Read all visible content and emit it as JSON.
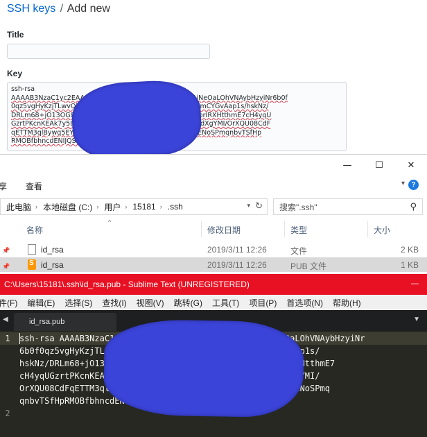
{
  "web": {
    "breadcrumb_link": "SSH keys",
    "breadcrumb_sep": "/",
    "breadcrumb_current": "Add new",
    "title_label": "Title",
    "key_label": "Key",
    "key_lines": [
      "ssh-rsa",
      "AAAAB3NzaC1yc2EAAAADAQABAAABAQDZ5Eb1RUGip1iNeOaLOhVNAybHzyiNr6b0f",
      "0qz5vgHyKzjTLwvQbN4sMOtAjwZ5jKuTnWaWeVqQjM+damCYGvAap1s/hskNz/",
      "DRLm68+jO13OG8a4YsH2eHkpL4jhf06uT90a7KJKNFMsVbrIRXHtthmE7cH4yqU",
      "GzrtPKcnKEAk7y5BQPW27l6RYiHm8skxTnrktFKMacRXKBtdXgYMI/OrXQU08CdF",
      "qETTM3qlBywq5EYv8bLmkNu0f1RyQDOav4Jw3BbfKgznFENoSPmqnbvTSfHp",
      "RMOBfbhncdENIJQSVXl5w9RYNoZw9"
    ]
  },
  "explorer": {
    "window_controls": [
      "—",
      "☐",
      "✕"
    ],
    "ribbon_tabs": [
      "享",
      "查看"
    ],
    "address_parts": [
      "此电脑",
      "本地磁盘 (C:)",
      "用户",
      "15181",
      ".ssh"
    ],
    "search_placeholder": "搜索\".ssh\"",
    "columns": {
      "name": "名称",
      "date": "修改日期",
      "type": "类型",
      "size": "大小"
    },
    "files": [
      {
        "name": "id_rsa",
        "date": "2019/3/11 12:26",
        "type": "文件",
        "size": "2 KB",
        "selected": false
      },
      {
        "name": "id_rsa",
        "date": "2019/3/11 12:26",
        "type": "PUB 文件",
        "size": "1 KB",
        "selected": true
      }
    ]
  },
  "sublime": {
    "title": "C:\\Users\\15181\\.ssh\\id_rsa.pub - Sublime Text (UNREGISTERED)",
    "menu": [
      "件(F)",
      "编辑(E)",
      "选择(S)",
      "查找(I)",
      "视图(V)",
      "跳转(G)",
      "工具(T)",
      "项目(P)",
      "首选项(N)",
      "帮助(H)"
    ],
    "tab_label": "id_rsa.pub",
    "line_numbers": [
      "1",
      "",
      "",
      "",
      "",
      "",
      "2"
    ],
    "code_lines": [
      "ssh-rsa AAAAB3NzaC1yc2EAAAADAQABAAABAQDZ5Eb1RUGip1iNeOaLOhVNAybHzyiNr",
      "6b0f0qz5vgHyKzjTLwvQbN4sMOtAjwZ5jKuTnWaWeVqQjM+damCYGvAap1s/",
      "hskNz/DRLm68+jO13OG8a4YsH2eHkpL4jhf06uT90a7KJKNFMsVbrIRXHtthmE7",
      "cH4yqUGzrtPKcnKEAk7y5BQPW27l6RYiHm8skxTnrktFKMacRXKBtdXgYMI/",
      "OrXQU08CdFqETTM3qlBywq5EYv8bLmkNu0f1RyQDOav4Jw3BbfKgznFENoSPmq",
      "qnbvTSfHpRMOBfbhncdENIJQSVXl5w9RYNoZw9",
      ""
    ]
  },
  "colors": {
    "titlebar": "#e81123",
    "editor_bg": "#272822",
    "link": "#0366d6",
    "redaction": "#3b44d8"
  }
}
